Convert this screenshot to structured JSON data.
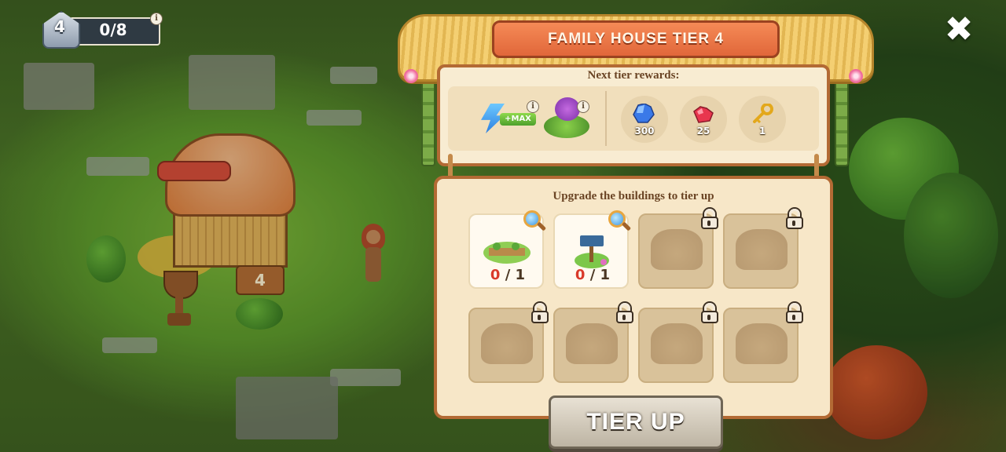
{
  "hud": {
    "level": "4",
    "progress": "0/8",
    "info_glyph": "i"
  },
  "dialog": {
    "title": "FAMILY HOUSE TIER 4",
    "close_glyph": "✖",
    "rewards_heading": "Next tier rewards:",
    "rewards": [
      {
        "icon": "energy-max-icon",
        "label": "+MAX",
        "info": "i"
      },
      {
        "icon": "island-decoration-icon",
        "info": "i"
      },
      {
        "icon": "blue-gems-icon",
        "amount": "300",
        "color": "#2f6de0"
      },
      {
        "icon": "rubies-icon",
        "amount": "25",
        "color": "#e0304a"
      },
      {
        "icon": "golden-key-icon",
        "amount": "1",
        "color": "#e8b022"
      }
    ],
    "buildings_heading": "Upgrade the buildings to tier up",
    "buildings": [
      {
        "state": "open",
        "icon": "garden-plot-icon",
        "progress_current": "0",
        "progress_total": "1"
      },
      {
        "state": "open",
        "icon": "signpost-icon",
        "progress_current": "0",
        "progress_total": "1"
      },
      {
        "state": "locked",
        "icon": "thatched-hut-icon"
      },
      {
        "state": "locked",
        "icon": "workshop-icon"
      },
      {
        "state": "locked",
        "icon": "stone-oven-icon"
      },
      {
        "state": "locked",
        "icon": "stone-slab-icon"
      },
      {
        "state": "locked",
        "icon": "tool-rack-icon"
      },
      {
        "state": "locked",
        "icon": "storage-hut-icon"
      }
    ],
    "button_label": "TIER UP"
  },
  "scene": {
    "sign_number": "4"
  },
  "colors": {
    "title_banner": "#e8703f",
    "panel_border": "#b36a34",
    "progress_zero": "#d93a2a"
  }
}
